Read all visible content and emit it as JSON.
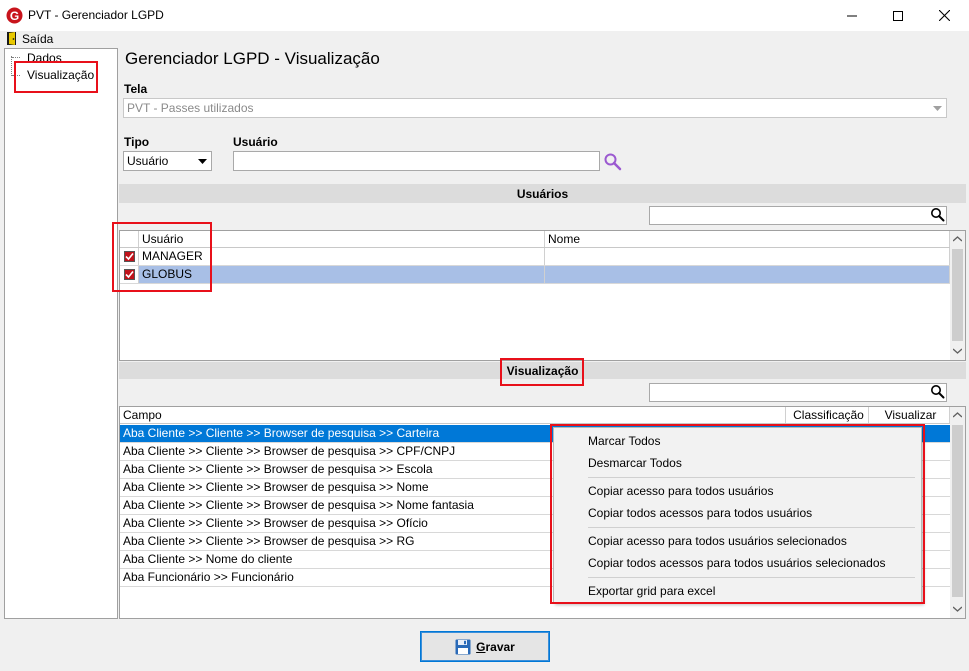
{
  "window": {
    "title": "PVT - Gerenciador LGPD",
    "icon": "app-logo-icon",
    "controls": [
      "minimize-icon",
      "maximize-icon",
      "close-icon"
    ]
  },
  "menu": {
    "exit_label": "Saída",
    "exit_icon": "door-exit-icon"
  },
  "tree": {
    "items": [
      {
        "label": "Dados"
      },
      {
        "label": "Visualização"
      }
    ]
  },
  "page_title": "Gerenciador LGPD - Visualização",
  "tela": {
    "label": "Tela",
    "value": "PVT - Passes utilizados"
  },
  "tipo": {
    "label": "Tipo",
    "value": "Usuário"
  },
  "usuario": {
    "label": "Usuário",
    "value": "",
    "search_icon": "magnifier-icon"
  },
  "users_section": {
    "title": "Usuários",
    "filter_value": "",
    "columns": [
      "Usuário",
      "Nome"
    ],
    "rows": [
      {
        "checked": true,
        "usuario": "MANAGER",
        "nome": ""
      },
      {
        "checked": true,
        "usuario": "GLOBUS",
        "nome": ""
      }
    ],
    "selected_row_color": "#a8bfe6"
  },
  "view_section": {
    "title": "Visualização",
    "filter_value": "",
    "columns": [
      "Campo",
      "Classificação",
      "Visualizar"
    ],
    "rows": [
      "Aba Cliente >> Cliente >> Browser de pesquisa >> Carteira",
      "Aba Cliente >> Cliente >> Browser de pesquisa >> CPF/CNPJ",
      "Aba Cliente >> Cliente >> Browser de pesquisa >> Escola",
      "Aba Cliente >> Cliente >> Browser de pesquisa >> Nome",
      "Aba Cliente >> Cliente >> Browser de pesquisa >> Nome fantasia",
      "Aba Cliente >> Cliente >> Browser de pesquisa >> Ofício",
      "Aba Cliente >> Cliente >> Browser de pesquisa >> RG",
      "Aba Cliente >> Nome do cliente",
      "Aba Funcionário >> Funcionário"
    ],
    "selected_row_color": "#0078d7"
  },
  "context_menu": {
    "items": [
      "Marcar Todos",
      "Desmarcar Todos",
      "Copiar acesso para todos usuários",
      "Copiar todos acessos para todos usuários",
      "Copiar acesso para todos usuários selecionados",
      "Copiar todos acessos para todos usuários selecionados",
      "Exportar grid para excel"
    ]
  },
  "save_button": {
    "label": "Gravar",
    "icon": "floppy-disk-icon"
  },
  "colors": {
    "highlight_annotation": "#e8101a",
    "accent": "#0078d7"
  }
}
